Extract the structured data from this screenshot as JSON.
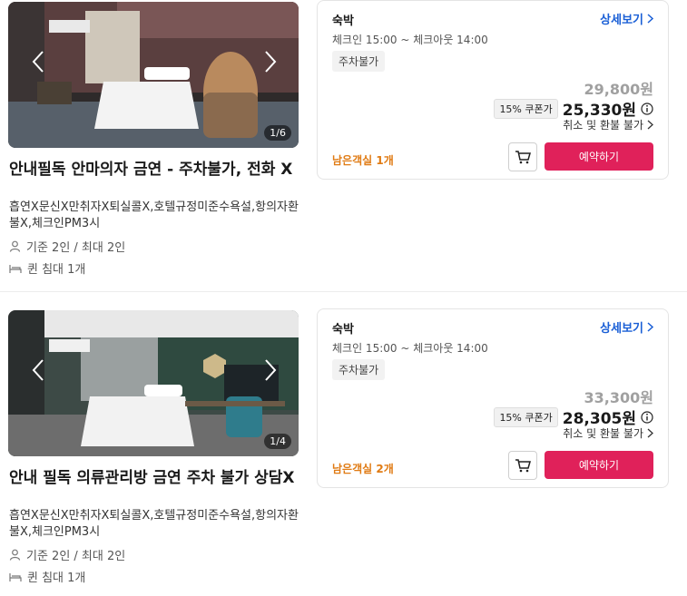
{
  "rooms": [
    {
      "title": "안내필독 안마의자 금연 - 주차불가, 전화 X",
      "description": "흡연X문신X만취자X퇴실콜X,호텔규정미준수욕설,항의자환불X,체크인PM3시",
      "capacity": "기준 2인 / 최대 2인",
      "bed": "퀸 침대 1개",
      "photo_counter": "1/6",
      "stay_label": "숙박",
      "detail_link": "상세보기",
      "check_times": "체크인 15:00 ~ 체크아웃 14:00",
      "parking_badge": "주차불가",
      "original_price": "29,800원",
      "coupon_label": "15% 쿠폰가",
      "discount_price": "25,330원",
      "refund_policy": "취소 및 환불 불가",
      "remaining": "남은객실 1개",
      "reserve_label": "예약하기"
    },
    {
      "title": "안내 필독 의류관리방 금연 주차 불가 상담X",
      "description": "흡연X문신X만취자X퇴실콜X,호텔규정미준수욕설,항의자환불X,체크인PM3시",
      "capacity": "기준 2인 / 최대 2인",
      "bed": "퀸 침대 1개",
      "photo_counter": "1/4",
      "stay_label": "숙박",
      "detail_link": "상세보기",
      "check_times": "체크인 15:00 ~ 체크아웃 14:00",
      "parking_badge": "주차불가",
      "original_price": "33,300원",
      "coupon_label": "15% 쿠폰가",
      "discount_price": "28,305원",
      "refund_policy": "취소 및 환불 불가",
      "remaining": "남은객실 2개",
      "reserve_label": "예약하기"
    }
  ],
  "colors": {
    "reserve_button": "#e0215a",
    "detail_link": "#1a5fd6",
    "remaining_text": "#e07b14",
    "original_price": "#a0a0a0"
  },
  "icons": [
    "chevron-left-icon",
    "chevron-right-icon",
    "person-icon",
    "bed-icon",
    "info-icon",
    "cart-icon"
  ]
}
